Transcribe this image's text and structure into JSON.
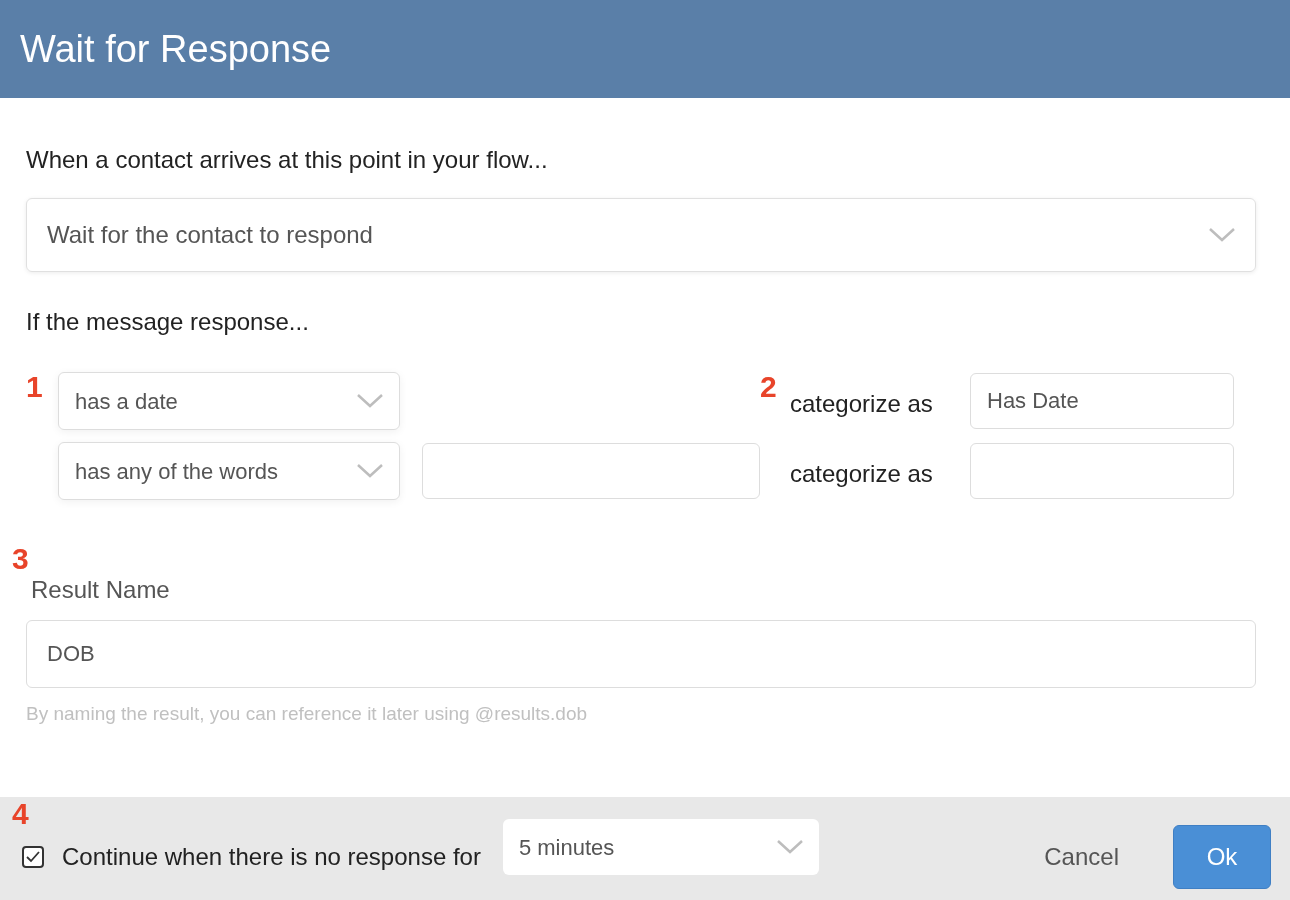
{
  "window": {
    "title": "Wait for Response"
  },
  "intro": "When a contact arrives at this point in your flow...",
  "wait_mode": {
    "value": "Wait for the contact to respond"
  },
  "rules_heading": "If the message response...",
  "rules": [
    {
      "kind": "no_argument",
      "marker": "1",
      "operator": "has a date",
      "category_marker": "2",
      "category_label": "categorize as",
      "category": "Has Date"
    },
    {
      "kind": "text_argument",
      "operator": "has any of the words",
      "category_label": "categorize as"
    }
  ],
  "result": {
    "marker": "3",
    "label": "Result Name",
    "value": "DOB",
    "help": "By naming the result, you can reference it later using @results.dob"
  },
  "footer": {
    "marker": "4",
    "timeout_checked": true,
    "timeout_label": "Continue when there is no response for",
    "timeout_value": "5 minutes",
    "buttons": [
      {
        "kind": "secondary",
        "label": "Cancel"
      },
      {
        "kind": "primary",
        "label": "Ok"
      }
    ]
  }
}
